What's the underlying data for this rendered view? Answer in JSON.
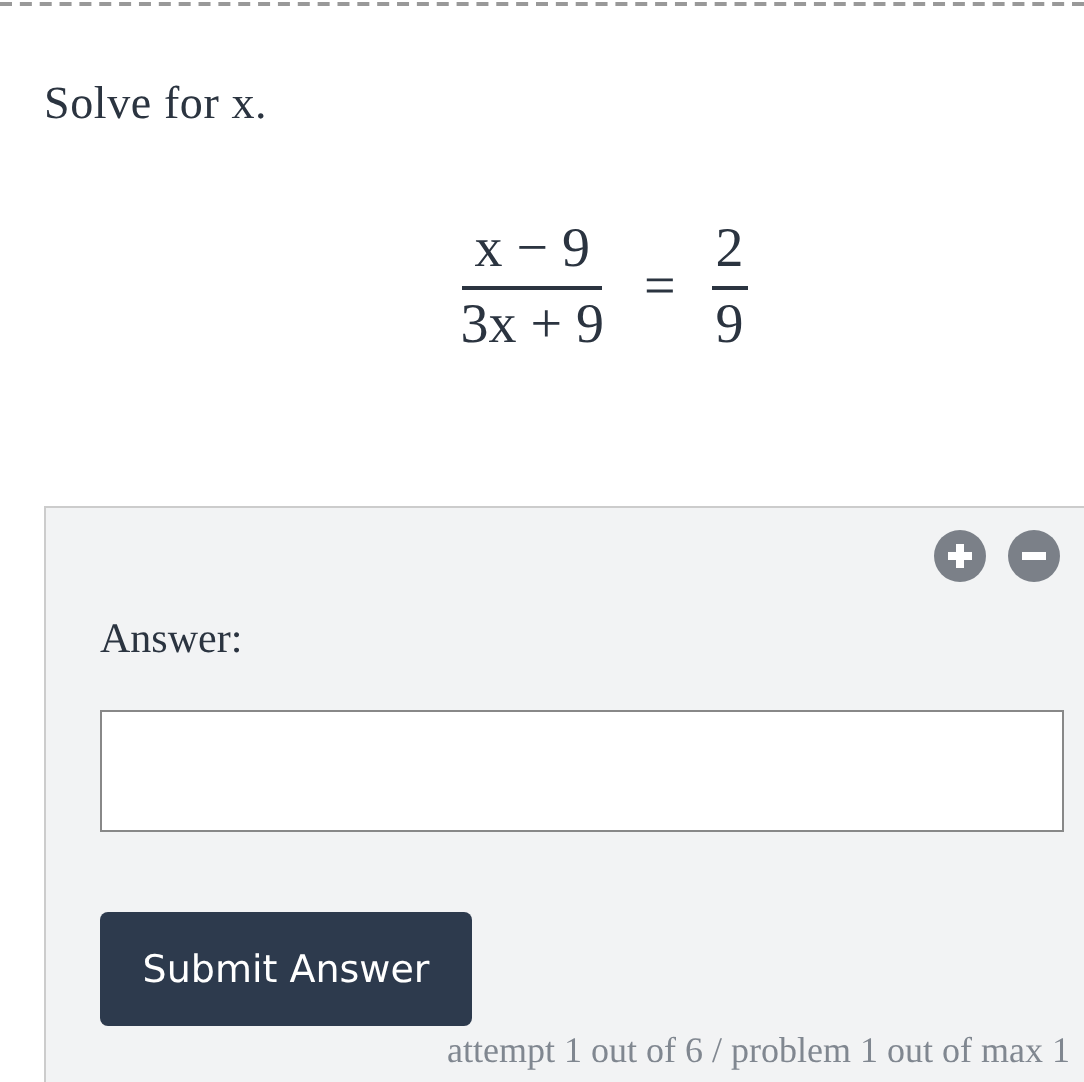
{
  "prompt": "Solve for x.",
  "equation": {
    "left_numerator": "x − 9",
    "left_denominator": "3x + 9",
    "relation": "=",
    "right_numerator": "2",
    "right_denominator": "9"
  },
  "answer_panel": {
    "label": "Answer:",
    "button": "Submit Answer",
    "attempt_info": "attempt 1 out of 6 / problem 1 out of max 1"
  }
}
